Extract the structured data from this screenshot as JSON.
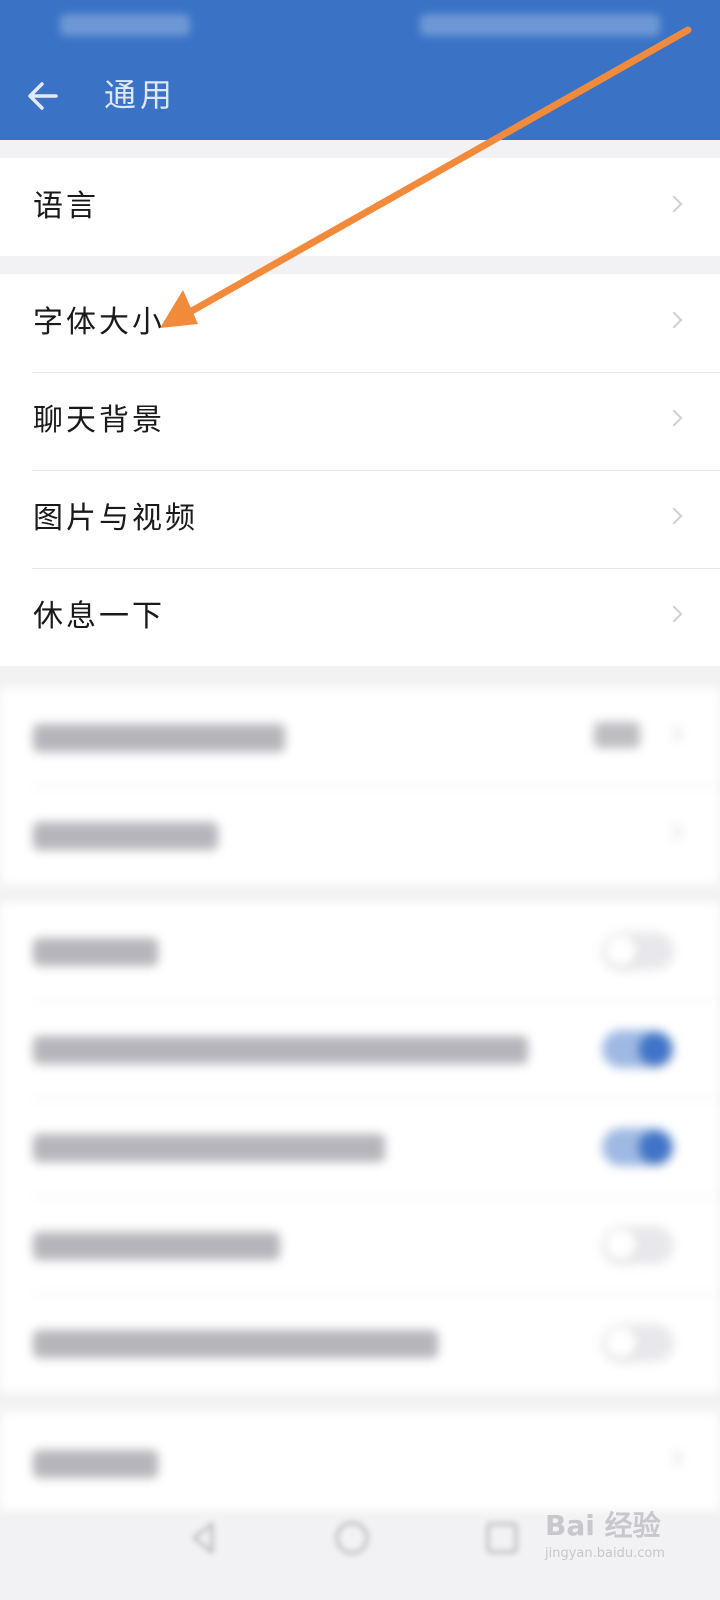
{
  "header": {
    "title": "通用",
    "back_icon": "back-arrow-icon",
    "color": "#3a73c6"
  },
  "groups": [
    {
      "items": [
        {
          "label": "语言"
        }
      ]
    },
    {
      "items": [
        {
          "label": "字体大小"
        },
        {
          "label": "聊天背景"
        },
        {
          "label": "图片与视频"
        },
        {
          "label": "休息一下"
        }
      ]
    }
  ],
  "blurred_toggles": [
    {
      "state": "off"
    },
    {
      "state": "on"
    },
    {
      "state": "on"
    },
    {
      "state": "off"
    },
    {
      "state": "off"
    }
  ],
  "annotation": {
    "arrow_color": "#f28a3c"
  },
  "watermark": {
    "text": "Bai 经验",
    "sub": "jingyan.baidu.com"
  }
}
